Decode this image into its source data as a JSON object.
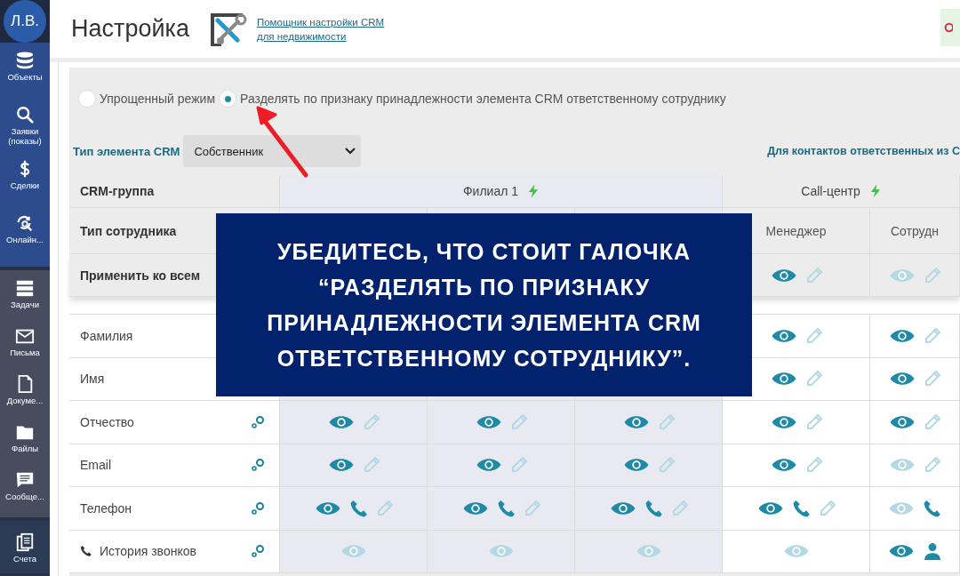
{
  "sidebar": {
    "avatar": "Л.В.",
    "groups": [
      {
        "kind": "primary",
        "items": [
          {
            "label": "Объекты"
          },
          {
            "label": "Заявки (показы)"
          },
          {
            "label": "Сделки"
          },
          {
            "label": "Онлайн..."
          }
        ]
      },
      {
        "kind": "secondary",
        "items": [
          {
            "label": "Задачи"
          },
          {
            "label": "Письма"
          },
          {
            "label": "Докуме..."
          },
          {
            "label": "Файлы"
          },
          {
            "label": "Сообще..."
          }
        ]
      },
      {
        "kind": "tertiary",
        "items": [
          {
            "label": "Счета"
          }
        ]
      }
    ]
  },
  "header": {
    "title": "Настройка",
    "helper_link": [
      "Помощник настройки CRM",
      "для недвижимости"
    ]
  },
  "mode_options": [
    {
      "label": "Упрощенный режим",
      "selected": false
    },
    {
      "label": "Разделять по признаку принадлежности элемента CRM ответственному сотруднику",
      "selected": true
    }
  ],
  "crm_type": {
    "label": "Тип элемента CRM",
    "value": "Собственник"
  },
  "contacts_link": "Для контактов ответственных из C",
  "table": {
    "group_header": "CRM-группа",
    "employee_header": "Тип сотрудника",
    "apply_label": "Применить ко всем",
    "groups": [
      {
        "name": "Филиал 1",
        "columns": [
          {
            "shaded": true
          },
          {
            "shaded": true
          },
          {
            "shaded": true
          }
        ]
      },
      {
        "name": "Call-центр",
        "columns": [
          {
            "shaded": false,
            "title": "Менеджер"
          },
          {
            "shaded": false,
            "title": "Сотрудн"
          }
        ]
      }
    ],
    "apply": [
      [
        {
          "kind": "eye",
          "on": true
        },
        {
          "kind": "pencil",
          "on": false
        }
      ],
      [
        {
          "kind": "eye",
          "on": false
        },
        {
          "kind": "pencil",
          "on": false
        }
      ]
    ],
    "rows": [
      {
        "label": "Фамилия",
        "phone_icon": false,
        "link_icon": false,
        "cells": [
          [
            {
              "kind": "eye",
              "on": true
            },
            {
              "kind": "pencil",
              "on": false
            }
          ],
          [
            {
              "kind": "eye",
              "on": true
            },
            {
              "kind": "pencil",
              "on": false
            }
          ]
        ]
      },
      {
        "label": "Имя",
        "phone_icon": false,
        "link_icon": false,
        "cells": [
          [
            {
              "kind": "eye",
              "on": true
            },
            {
              "kind": "pencil",
              "on": false
            }
          ],
          [
            {
              "kind": "eye",
              "on": true
            },
            {
              "kind": "pencil",
              "on": false
            }
          ]
        ]
      },
      {
        "label": "Отчество",
        "phone_icon": false,
        "link_icon": true,
        "cells": [
          [
            {
              "kind": "eye",
              "on": true
            },
            {
              "kind": "pencil",
              "on": false
            }
          ],
          [
            {
              "kind": "eye",
              "on": true
            },
            {
              "kind": "pencil",
              "on": false
            }
          ],
          [
            {
              "kind": "eye",
              "on": true
            },
            {
              "kind": "pencil",
              "on": false
            }
          ],
          [
            {
              "kind": "eye",
              "on": true
            },
            {
              "kind": "pencil",
              "on": false
            }
          ],
          [
            {
              "kind": "eye",
              "on": true
            },
            {
              "kind": "pencil",
              "on": false
            }
          ]
        ]
      },
      {
        "label": "Email",
        "phone_icon": false,
        "link_icon": true,
        "cells": [
          [
            {
              "kind": "eye",
              "on": true
            },
            {
              "kind": "pencil",
              "on": false
            }
          ],
          [
            {
              "kind": "eye",
              "on": true
            },
            {
              "kind": "pencil",
              "on": false
            }
          ],
          [
            {
              "kind": "eye",
              "on": true
            },
            {
              "kind": "pencil",
              "on": false
            }
          ],
          [
            {
              "kind": "eye",
              "on": true
            },
            {
              "kind": "pencil",
              "on": false
            }
          ],
          [
            {
              "kind": "eye",
              "on": false
            },
            {
              "kind": "pencil",
              "on": false
            }
          ]
        ]
      },
      {
        "label": "Телефон",
        "phone_icon": false,
        "link_icon": true,
        "cells": [
          [
            {
              "kind": "eye",
              "on": true
            },
            {
              "kind": "phone",
              "on": true
            },
            {
              "kind": "pencil",
              "on": false
            }
          ],
          [
            {
              "kind": "eye",
              "on": true
            },
            {
              "kind": "phone",
              "on": true
            },
            {
              "kind": "pencil",
              "on": false
            }
          ],
          [
            {
              "kind": "eye",
              "on": true
            },
            {
              "kind": "phone",
              "on": true
            },
            {
              "kind": "pencil",
              "on": false
            }
          ],
          [
            {
              "kind": "eye",
              "on": true
            },
            {
              "kind": "phone",
              "on": true
            },
            {
              "kind": "pencil",
              "on": false
            }
          ],
          [
            {
              "kind": "eye",
              "on": false
            },
            {
              "kind": "phone",
              "on": true
            }
          ]
        ]
      },
      {
        "label": "История звонков",
        "phone_icon": true,
        "link_icon": true,
        "cells": [
          [
            {
              "kind": "eye",
              "on": false
            }
          ],
          [
            {
              "kind": "eye",
              "on": false
            }
          ],
          [
            {
              "kind": "eye",
              "on": false
            }
          ],
          [
            {
              "kind": "eye",
              "on": false
            }
          ],
          [
            {
              "kind": "eye",
              "on": true
            },
            {
              "kind": "person",
              "on": true
            }
          ]
        ]
      }
    ]
  },
  "callout": {
    "lines": [
      "УБЕДИТЕСЬ, ЧТО СТОИТ ГАЛОЧКА",
      "“РАЗДЕЛЯТЬ ПО ПРИЗНАКУ",
      "ПРИНАДЛЕЖНОСТИ ЭЛЕМЕНТА CRM",
      "ОТВЕТСТВЕННОМУ СОТРУДНИКУ”."
    ]
  }
}
